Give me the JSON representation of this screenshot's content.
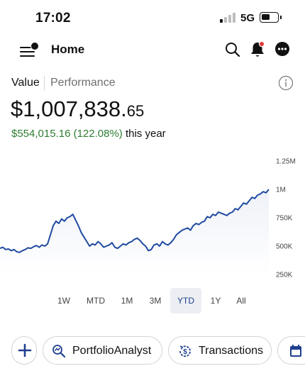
{
  "status_bar": {
    "time": "17:02",
    "network": "5G"
  },
  "header": {
    "title": "Home",
    "icons": [
      "menu-user-icon",
      "search-icon",
      "bell-icon",
      "more-icon"
    ],
    "notification_color": "#e53935"
  },
  "value_section": {
    "tabs": [
      "Value",
      "Performance"
    ],
    "active_tab": "Value",
    "total_main": "$1,007,838.",
    "total_cents": "65",
    "change_amount": "$554,015.16 (122.08%)",
    "change_period": "this year",
    "gain_color": "#2e7d32"
  },
  "chart_data": {
    "type": "area",
    "title": "",
    "xlabel": "",
    "ylabel": "",
    "ylim": [
      250000,
      1250000
    ],
    "y_ticks": [
      "1.25M",
      "1M",
      "750K",
      "500K",
      "250K"
    ],
    "y_tick_values": [
      1250000,
      1000000,
      750000,
      500000,
      250000
    ],
    "line_color": "#1f4aa0",
    "fill_color": "#eef1f7",
    "series": [
      {
        "values": [
          480000,
          490000,
          470000,
          475000,
          460000,
          470000,
          450000,
          445000,
          460000,
          470000,
          485000,
          480000,
          495000,
          505000,
          490000,
          510000,
          500000,
          520000,
          600000,
          680000,
          720000,
          700000,
          740000,
          720000,
          750000,
          760000,
          780000,
          730000,
          680000,
          620000,
          580000,
          540000,
          500000,
          520000,
          510000,
          540000,
          520000,
          490000,
          500000,
          510000,
          530000,
          490000,
          480000,
          500000,
          520000,
          510000,
          530000,
          540000,
          560000,
          570000,
          550000,
          520000,
          500000,
          460000,
          470000,
          510000,
          520000,
          500000,
          540000,
          520000,
          510000,
          530000,
          560000,
          600000,
          620000,
          640000,
          650000,
          660000,
          640000,
          680000,
          700000,
          690000,
          710000,
          720000,
          760000,
          750000,
          780000,
          770000,
          800000,
          790000,
          780000,
          770000,
          790000,
          800000,
          830000,
          820000,
          850000,
          880000,
          870000,
          900000,
          930000,
          920000,
          950000,
          960000,
          980000,
          970000,
          1000000
        ]
      }
    ]
  },
  "range_selector": {
    "options": [
      "1W",
      "MTD",
      "1M",
      "3M",
      "YTD",
      "1Y",
      "All"
    ],
    "active": "YTD"
  },
  "shortcuts": {
    "add_icon": "plus-icon",
    "items": [
      {
        "label": "PortfolioAnalyst",
        "icon": "analysis-search-icon"
      },
      {
        "label": "Transactions",
        "icon": "dollar-refresh-icon"
      },
      {
        "label": "",
        "icon": "calendar-icon"
      }
    ],
    "icon_color": "#1f3f8f"
  }
}
